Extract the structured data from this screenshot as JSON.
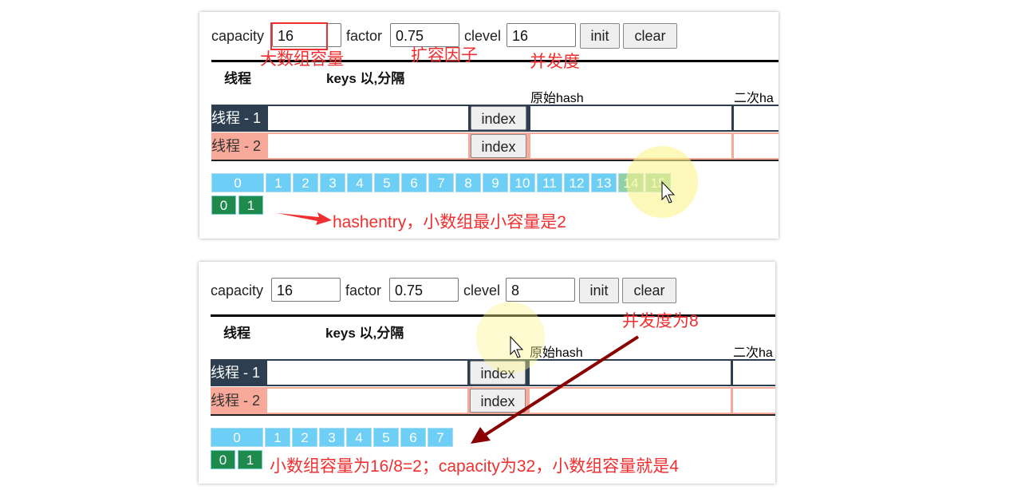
{
  "colors": {
    "thread1": "#2c3e50",
    "thread2": "#f9a99a",
    "segment": "#6dcff6",
    "hashentry": "#1e8a4c",
    "annotation": "#f03030"
  },
  "panels": [
    {
      "capacity_label": "capacity",
      "capacity": "16",
      "factor_label": "factor",
      "factor": "0.75",
      "clevel_label": "clevel",
      "clevel": "16",
      "init": "init",
      "clear": "clear",
      "col_thread": "线程",
      "col_keys": "keys 以,分隔",
      "col_hash": "原始hash",
      "col_hash2": "二次ha",
      "threads": [
        {
          "name": "线程 - 1",
          "index": "index"
        },
        {
          "name": "线程 - 2",
          "index": "index"
        }
      ],
      "segments": [
        "0",
        "1",
        "2",
        "3",
        "4",
        "5",
        "6",
        "7",
        "8",
        "9",
        "10",
        "11",
        "12",
        "13",
        "14",
        "15"
      ],
      "entries": [
        "0",
        "1"
      ],
      "annotations": {
        "capacity": "大数组容量",
        "factor": "扩容因子",
        "clevel": "并发度",
        "entry": "hashentry，小数组最小容量是2"
      }
    },
    {
      "capacity_label": "capacity",
      "capacity": "16",
      "factor_label": "factor",
      "factor": "0.75",
      "clevel_label": "clevel",
      "clevel": "8",
      "init": "init",
      "clear": "clear",
      "col_thread": "线程",
      "col_keys": "keys 以,分隔",
      "col_hash": "原始hash",
      "col_hash2": "二次ha",
      "threads": [
        {
          "name": "线程 - 1",
          "index": "index"
        },
        {
          "name": "线程 - 2",
          "index": "index"
        }
      ],
      "segments": [
        "0",
        "1",
        "2",
        "3",
        "4",
        "5",
        "6",
        "7"
      ],
      "entries": [
        "0",
        "1"
      ],
      "annotations": {
        "clevel": "并发度为8",
        "entry": "小数组容量为16/8=2；capacity为32，小数组容量就是4"
      }
    }
  ]
}
